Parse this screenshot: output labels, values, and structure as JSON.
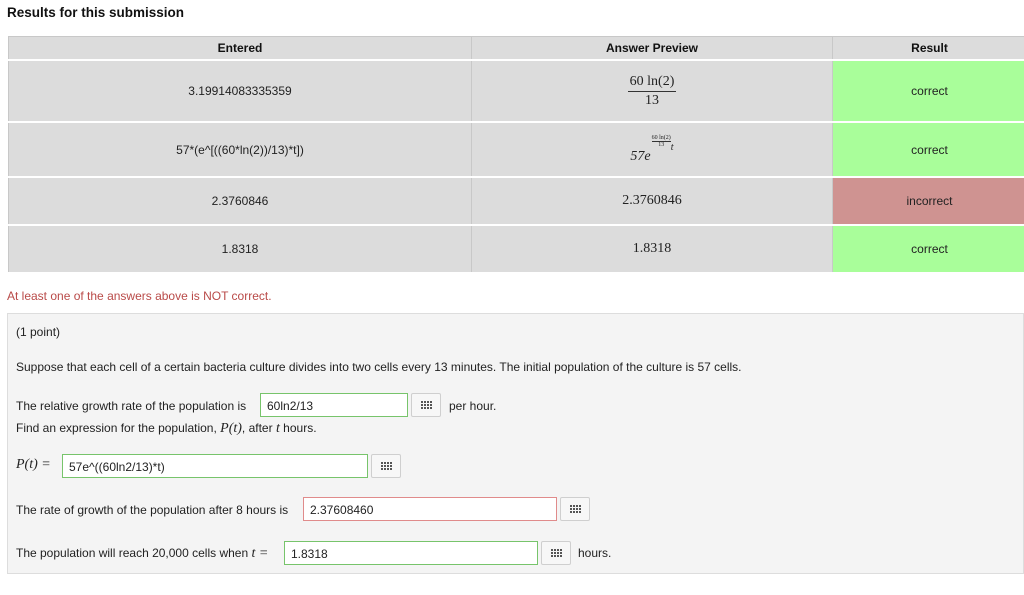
{
  "heading": "Results for this submission",
  "table": {
    "headers": [
      "Entered",
      "Answer Preview",
      "Result"
    ],
    "rows": [
      {
        "entered": "3.19914083335359",
        "preview_num": "60 ln(2)",
        "preview_den": "13",
        "result": "correct",
        "status": "correct"
      },
      {
        "entered": "57*(e^[((60*ln(2))/13)*t])",
        "preview_base": "57e",
        "preview_exp_num": "60 ln(2)",
        "preview_exp_den": "13",
        "preview_exp_var": "t",
        "result": "correct",
        "status": "correct"
      },
      {
        "entered": "2.3760846",
        "preview": "2.3760846",
        "result": "incorrect",
        "status": "incorrect"
      },
      {
        "entered": "1.8318",
        "preview": "1.8318",
        "result": "correct",
        "status": "correct"
      }
    ]
  },
  "warning": "At least one of the answers above is NOT correct.",
  "problem": {
    "points": "(1 point)",
    "statement": "Suppose that each cell of a certain bacteria culture divides into two cells every 13 minutes. The initial population of the culture is 57 cells.",
    "q1_prefix": "The relative growth rate of the population is",
    "q1_answer": "60ln2/13",
    "q1_suffix": "per hour.",
    "q2_prefix": "Find an expression for the population,",
    "q2_func": "P(t)",
    "q2_mid": ", after",
    "q2_var": "t",
    "q2_suffix": "hours.",
    "q2_label": "P(t) =",
    "q2_answer": "57e^((60ln2/13)*t)",
    "q3_prefix": "The rate of growth of the population after 8 hours is",
    "q3_answer": "2.37608460",
    "q4_prefix": "The population will reach 20,000 cells when",
    "q4_var_label": "t =",
    "q4_answer": "1.8318",
    "q4_suffix": "hours."
  },
  "colors": {
    "correct": "#a9fe9a",
    "incorrect": "#cf9391",
    "warning": "#b94a48",
    "result_text": "#2a3fb8"
  },
  "icons": {
    "equation_editor": "grid-keypad-icon"
  }
}
